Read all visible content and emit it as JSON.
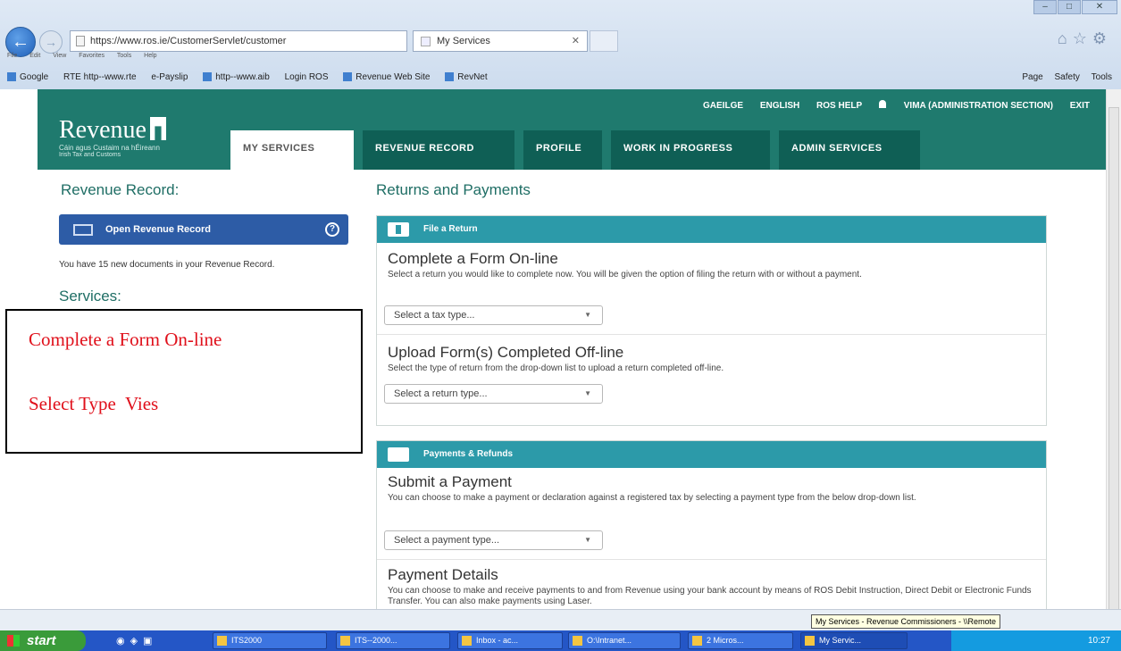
{
  "browser": {
    "address": "https://www.ros.ie/CustomerServlet/customer",
    "tab_title": "My Services",
    "menu": [
      "File",
      "Edit",
      "View",
      "Favorites",
      "Tools",
      "Help"
    ],
    "favorites": [
      "Google",
      "RTE http--www.rte",
      "e-Payslip",
      "http--www.aib",
      "Login ROS",
      "Revenue Web Site",
      "RevNet"
    ],
    "commands": [
      "Page",
      "Safety",
      "Tools"
    ]
  },
  "header": {
    "logo_text": "Revenue",
    "tagline1": "Cáin agus Custaim na hÉireann",
    "tagline2": "Irish Tax and Customs",
    "links": [
      "GAEILGE",
      "ENGLISH",
      "ROS HELP"
    ],
    "user": "VIMA (ADMINISTRATION SECTION)",
    "exit": "EXIT",
    "tabs": [
      "MY SERVICES",
      "REVENUE RECORD",
      "PROFILE",
      "WORK IN PROGRESS",
      "ADMIN SERVICES"
    ]
  },
  "left": {
    "title": "Revenue Record:",
    "open_button": "Open Revenue Record",
    "docs_text": "You have 15 new documents in your Revenue Record.",
    "services_title": "Services:",
    "annotation1": "Complete a Form On-line",
    "annotation2": "Select Type  Vies"
  },
  "main": {
    "title": "Returns and Payments",
    "file_return": {
      "header": "File a Return",
      "complete_title": "Complete a Form On-line",
      "complete_desc": "Select a return you would like to complete now. You will be given the option of filing the return with or without a payment.",
      "tax_type_placeholder": "Select a tax type...",
      "upload_title": "Upload Form(s) Completed Off-line",
      "upload_desc": "Select the type of return from the drop-down list to upload a return completed off-line.",
      "return_type_placeholder": "Select a return type..."
    },
    "payments": {
      "header": "Payments & Refunds",
      "submit_title": "Submit a Payment",
      "submit_desc": "You can choose to make a payment or declaration against a registered tax by selecting a payment type from the below drop-down list.",
      "payment_type_placeholder": "Select a payment type...",
      "details_title": "Payment Details",
      "details_desc": "You can choose to make and receive payments to and from Revenue using your bank account by means of ROS Debit Instruction, Direct Debit or Electronic Funds Transfer. You can also make payments using Laser."
    }
  },
  "tooltip": "My Services - Revenue Commissioners - \\\\Remote",
  "taskbar": {
    "start": "start",
    "tasks": [
      "ITS2000",
      "ITS--2000...",
      "Inbox - ac...",
      "O:\\Intranet...",
      "2 Micros...",
      "My Servic..."
    ],
    "clock": "10:27"
  }
}
